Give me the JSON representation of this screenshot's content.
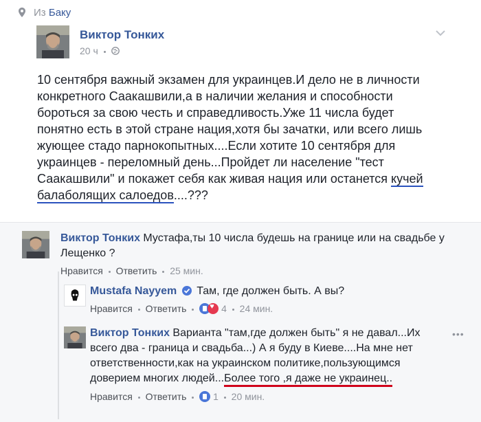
{
  "location": {
    "prefix": "Из",
    "place": "Баку"
  },
  "post": {
    "author": "Виктор Тонких",
    "time": "20 ч",
    "text_lines": [
      "10 сентября важный экзамен для украинцев.И дело не в личности",
      "конкретного Саакашвили,а в наличии желания и способности",
      "бороться за свою честь и справедливость.Уже 11 числа будет",
      "понятно есть в этой стране нация,хотя бы зачатки, или всего лишь",
      "жующее стадо парнокопытных....Если хотите 10 сентября для",
      "украинцев - переломный день...Пройдет ли население \"тест",
      "Саакашвили\" и покажет себя как живая нация или останется "
    ],
    "underlined_1": "кучей",
    "underlined_2": "балаболящих салоедов",
    "tail": "....???"
  },
  "comments": [
    {
      "author": "Виктор Тонких",
      "line1": "Мустафа,ты 10 числа будешь на границе или на свадьбе у",
      "line2": "Лещенко ?",
      "like": "Нравится",
      "reply": "Ответить",
      "time": "25 мин."
    },
    {
      "author": "Mustafa Nayyem",
      "text": "Там, где должен быть. А вы?",
      "like": "Нравится",
      "reply": "Ответить",
      "reactions_count": "4",
      "time": "24 мин."
    },
    {
      "author": "Виктор Тонких",
      "line1": "Варианта \"там,где должен быть\" я не давал...Их",
      "line2": "всего два - граница и свадьба...) А я буду в Киеве....На мне нет",
      "line3": "ответственности,как на украинском политике,пользующимся",
      "line4_a": "доверием многих людей...",
      "line4_b": "Более того ,я даже не украинец..",
      "like": "Нравится",
      "reply": "Ответить",
      "reactions_count": "1",
      "time": "20 мин."
    }
  ],
  "icons": {
    "location": "location-pin-icon",
    "globe": "globe-icon",
    "options": "chevron-down-icon",
    "verified": "verified-badge-icon",
    "more": "more-dots-icon"
  },
  "colors": {
    "link": "#365899",
    "meta": "#90949c",
    "underline_blue": "#2a52be",
    "underline_red": "#d0021b",
    "verified": "#4a76d8"
  }
}
